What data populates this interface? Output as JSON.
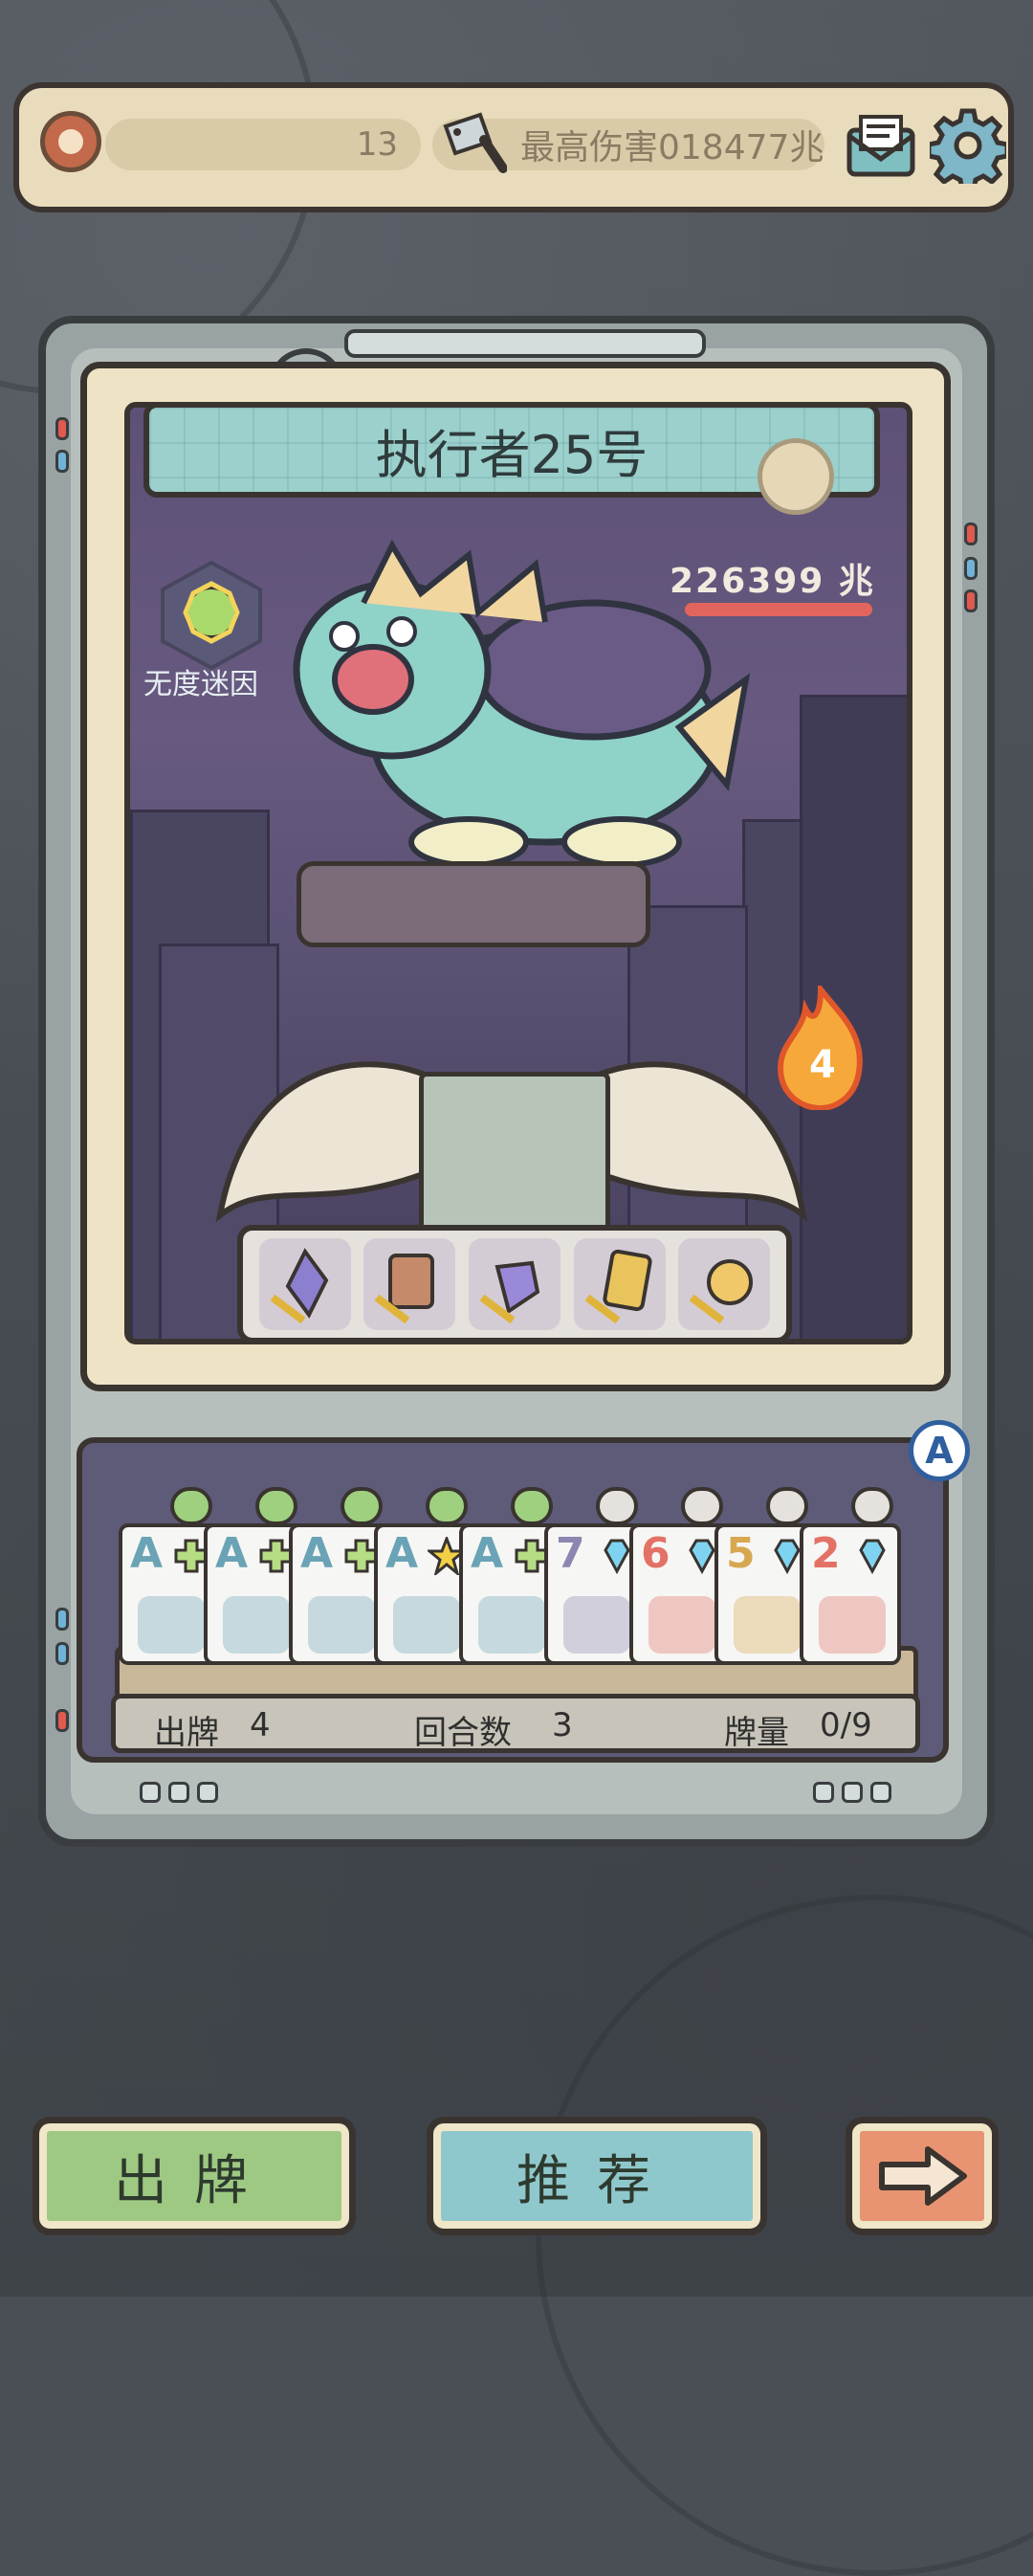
{
  "top_bar": {
    "level": "13",
    "high_damage": "最高伤害018477兆"
  },
  "boss": {
    "name": "执行者25号",
    "hp": "226399 兆",
    "buff_label": "无度迷因"
  },
  "fire_count": "4",
  "hand": {
    "auto_label": "A",
    "cards": [
      {
        "rank": "A",
        "color": "#6aa3b5",
        "suit": "plus"
      },
      {
        "rank": "A",
        "color": "#6aa3b5",
        "suit": "plus"
      },
      {
        "rank": "A",
        "color": "#6aa3b5",
        "suit": "plus"
      },
      {
        "rank": "A",
        "color": "#6aa3b5",
        "suit": "star"
      },
      {
        "rank": "A",
        "color": "#6aa3b5",
        "suit": "plus"
      },
      {
        "rank": "7",
        "color": "#8e86b0",
        "suit": "diamond"
      },
      {
        "rank": "6",
        "color": "#e37165",
        "suit": "diamond"
      },
      {
        "rank": "5",
        "color": "#d7a84f",
        "suit": "diamond"
      },
      {
        "rank": "2",
        "color": "#e37165",
        "suit": "diamond"
      }
    ]
  },
  "status": {
    "plays_label": "出牌",
    "plays_value": "4",
    "rounds_label": "回合数",
    "rounds_value": "3",
    "deck_label": "牌量",
    "deck_value": "0/9"
  },
  "buttons": {
    "play": "出牌",
    "recommend": "推荐"
  }
}
